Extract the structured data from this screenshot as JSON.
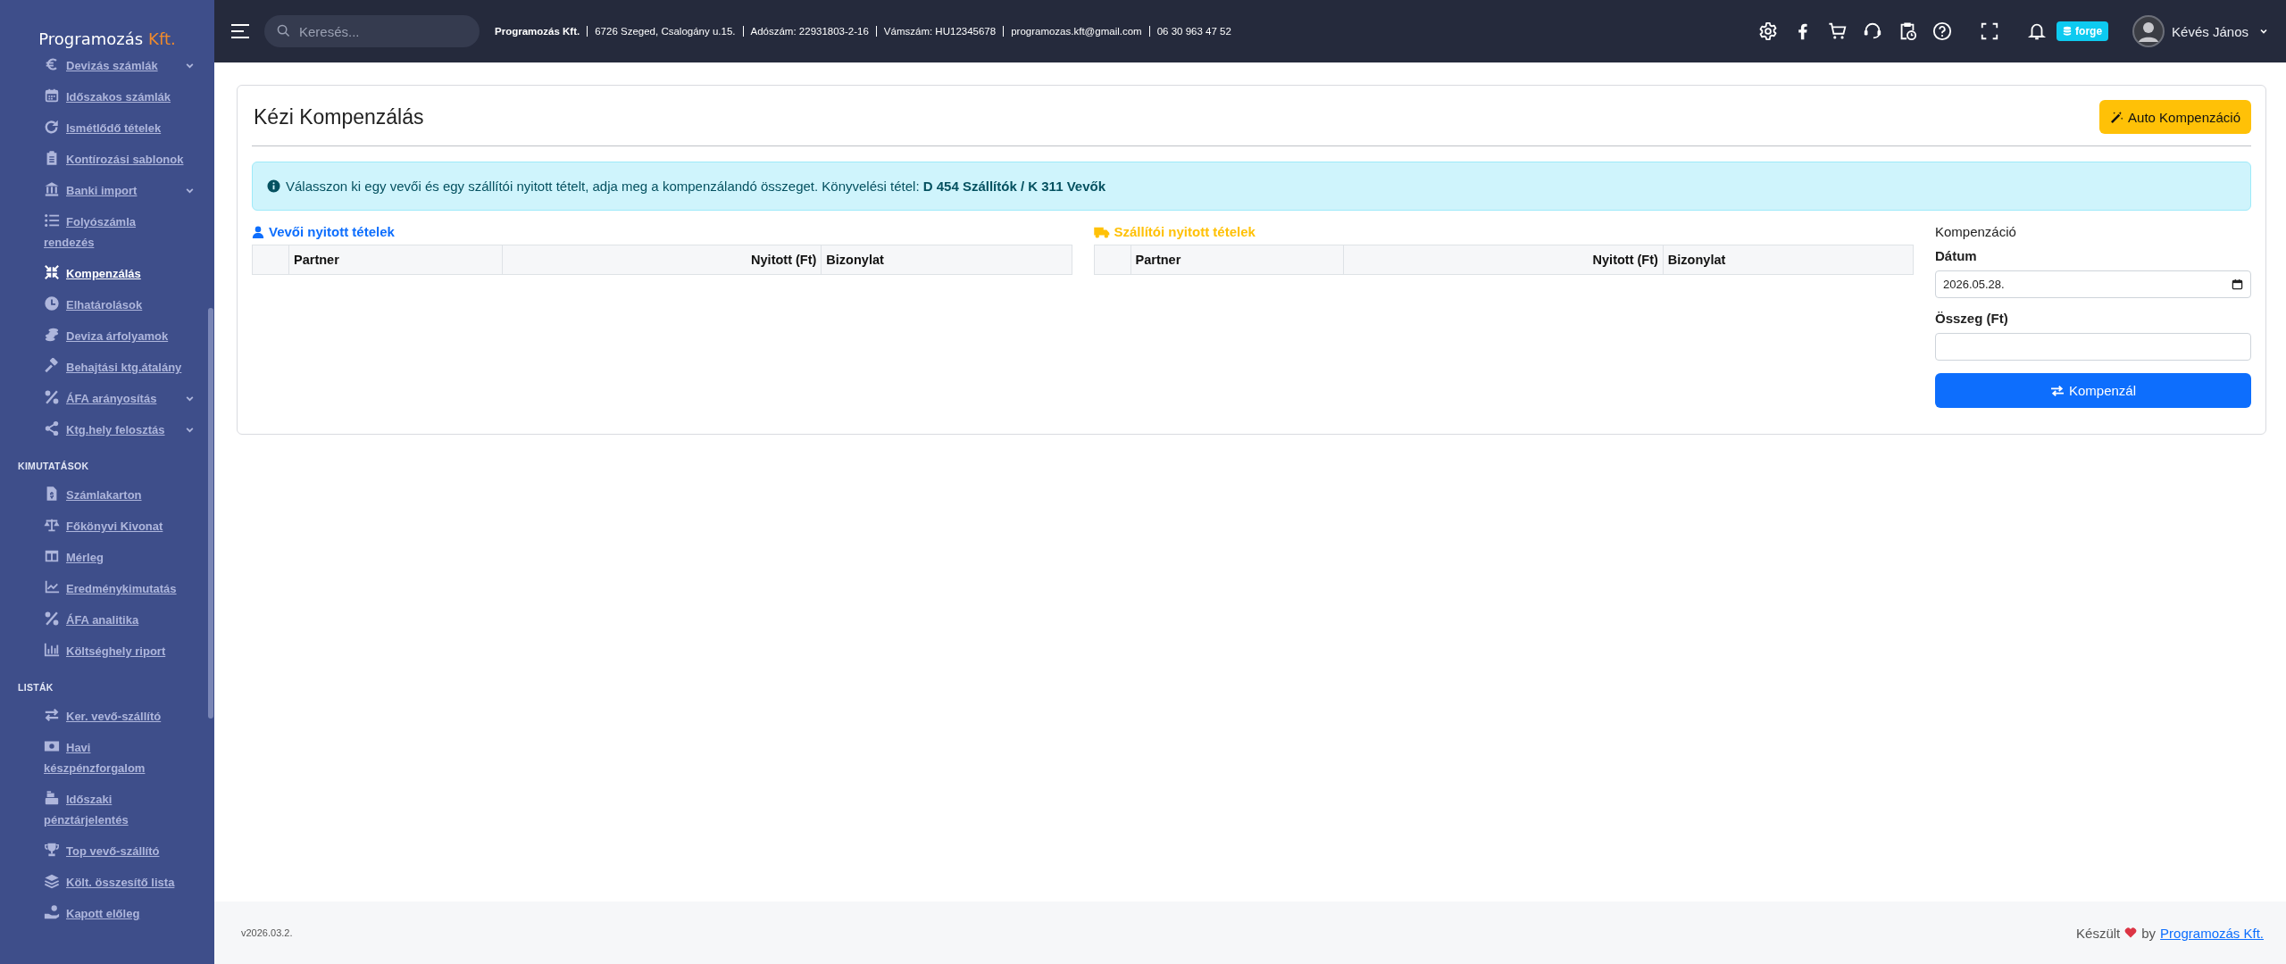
{
  "sidebar": {
    "brand": {
      "name": "Programozás",
      "suffix": "Kft."
    },
    "items": [
      {
        "kind": "item",
        "label": "Devizás számlák",
        "selected": false,
        "expandable": true
      },
      {
        "kind": "item",
        "label": "Időszakos számlák",
        "selected": false,
        "expandable": false
      },
      {
        "kind": "item",
        "label": "Ismétlődő tételek",
        "selected": false,
        "expandable": false
      },
      {
        "kind": "item",
        "label": "Kontírozási sablonok",
        "selected": false,
        "expandable": false
      },
      {
        "kind": "item",
        "label": "Banki import",
        "selected": false,
        "expandable": true
      },
      {
        "kind": "item",
        "label": "Folyószámla rendezés",
        "selected": false,
        "expandable": false
      },
      {
        "kind": "item",
        "label": "Kompenzálás",
        "selected": true,
        "expandable": false
      },
      {
        "kind": "item",
        "label": "Elhatárolások",
        "selected": false,
        "expandable": false
      },
      {
        "kind": "item",
        "label": "Deviza árfolyamok",
        "selected": false,
        "expandable": false
      },
      {
        "kind": "item",
        "label": "Behajtási ktg.átalány",
        "selected": false,
        "expandable": false
      },
      {
        "kind": "item",
        "label": "ÁFA arányosítás",
        "selected": false,
        "expandable": true
      },
      {
        "kind": "item",
        "label": "Ktg.hely felosztás",
        "selected": false,
        "expandable": true
      },
      {
        "kind": "section",
        "label": "KIMUTATÁSOK"
      },
      {
        "kind": "item",
        "label": "Számlakarton",
        "selected": false,
        "expandable": false
      },
      {
        "kind": "item",
        "label": "Főkönyvi Kivonat",
        "selected": false,
        "expandable": false
      },
      {
        "kind": "item",
        "label": "Mérleg",
        "selected": false,
        "expandable": false
      },
      {
        "kind": "item",
        "label": "Eredménykimutatás",
        "selected": false,
        "expandable": false
      },
      {
        "kind": "item",
        "label": "ÁFA analitika",
        "selected": false,
        "expandable": false
      },
      {
        "kind": "item",
        "label": "Költséghely riport",
        "selected": false,
        "expandable": false
      },
      {
        "kind": "section",
        "label": "LISTÁK"
      },
      {
        "kind": "item",
        "label": "Ker. vevő-szállító",
        "selected": false,
        "expandable": false
      },
      {
        "kind": "item",
        "label": "Havi készpénzforgalom",
        "selected": false,
        "expandable": false
      },
      {
        "kind": "item",
        "label": "Időszaki pénztárjelentés",
        "selected": false,
        "expandable": false
      },
      {
        "kind": "item",
        "label": "Top vevő-szállító",
        "selected": false,
        "expandable": false
      },
      {
        "kind": "item",
        "label": "Költ. összesítő lista",
        "selected": false,
        "expandable": false
      },
      {
        "kind": "item",
        "label": "Kapott előleg",
        "selected": false,
        "expandable": false
      }
    ]
  },
  "topbar": {
    "search": {
      "placeholder": "Keresés..."
    },
    "company_info": [
      {
        "text": "Programozás Kft.",
        "bold": true
      },
      {
        "text": "6726 Szeged, Csalogány u.15.",
        "bold": false
      },
      {
        "text": "Adószám: 22931803-2-16",
        "bold": false
      },
      {
        "text": "Vámszám: HU12345678",
        "bold": false
      },
      {
        "text": "programozas.kft@gmail.com",
        "bold": false
      },
      {
        "text": "06 30 963 47 52",
        "bold": false
      }
    ],
    "badge": "forge",
    "user": {
      "name": "Kévés János"
    }
  },
  "page": {
    "title": "Kézi Kompenzálás",
    "auto_button": "Auto Kompenzáció",
    "alert": "Válasszon ki egy vevői és egy szállítói nyitott tételt, adja meg a kompenzálandó összeget. Könyvelési tétel: **D 454 Szállítók / K 311 Vevők**",
    "panels": [
      {
        "kind": "customer",
        "title": "Vevői nyitott tételek",
        "columns": [
          "Partner",
          "Nyitott (Ft)",
          "Bizonylat"
        ]
      },
      {
        "kind": "supplier",
        "title": "Szállítói nyitott tételek",
        "columns": [
          "Partner",
          "Nyitott (Ft)",
          "Bizonylat"
        ]
      }
    ],
    "form": {
      "title": "Kompenzáció",
      "fields": [
        {
          "kind": "date",
          "label": "Dátum",
          "value": "2026.05.28."
        },
        {
          "kind": "number",
          "label": "Összeg (Ft)"
        }
      ],
      "submit": "Kompenzál"
    }
  },
  "footer": {
    "version": "v2026.03.2.",
    "credit": "Készült",
    "by": "by",
    "link": "Programozás Kft."
  }
}
